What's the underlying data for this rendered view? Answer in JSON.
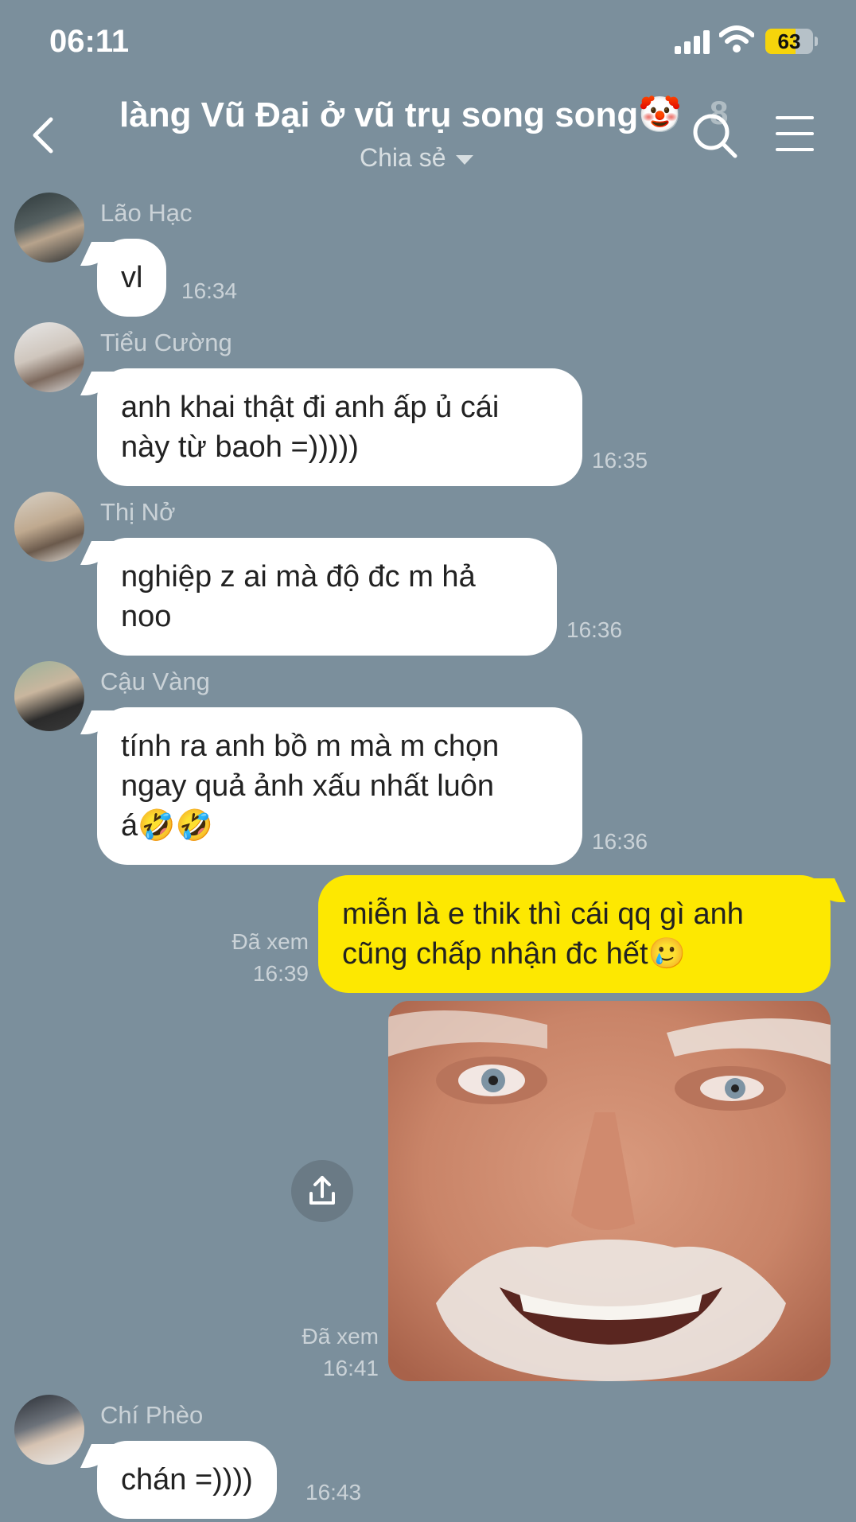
{
  "status_bar": {
    "time": "06:11",
    "battery": "63",
    "battery_level": 0.63
  },
  "header": {
    "title": "làng Vũ Đại ở vũ trụ song song🤡",
    "member_count": "8",
    "subtitle": "Chia sẻ",
    "icons": {
      "back": "back-chevron-icon",
      "search": "search-icon",
      "menu": "menu-icon"
    }
  },
  "messages": [
    {
      "sender": "Lão Hạc",
      "lines": [
        "vl"
      ],
      "time": "16:34"
    },
    {
      "sender": "Tiểu Cường",
      "lines": [
        "anh khai thật đi anh ấp ủ cái",
        "này từ baoh =)))))"
      ],
      "time": "16:35"
    },
    {
      "sender": "Thị Nở",
      "lines": [
        "nghiệp z ai mà độ đc m hả",
        "noo"
      ],
      "time": "16:36"
    },
    {
      "sender": "Cậu Vàng",
      "lines": [
        "tính ra anh bồ m mà m chọn",
        "ngay quả ảnh xấu nhất luôn",
        "á🤣🤣"
      ],
      "time": "16:36"
    },
    {
      "sender": "me",
      "lines": [
        "miễn là e thik thì cái qq gì anh",
        "cũng chấp nhận đc hết🥲"
      ],
      "seen": "Đã xem",
      "time": "16:39"
    },
    {
      "sender": "me",
      "type": "image",
      "image": "photo-of-smiling-elderly-man",
      "seen": "Đã xem",
      "time": "16:41"
    },
    {
      "sender": "Chí Phèo",
      "lines": [
        "chán =))))"
      ],
      "time": "16:43"
    }
  ],
  "colors": {
    "background": "#7b8f9c",
    "incoming_bubble": "#ffffff",
    "outgoing_bubble": "#fde801"
  }
}
